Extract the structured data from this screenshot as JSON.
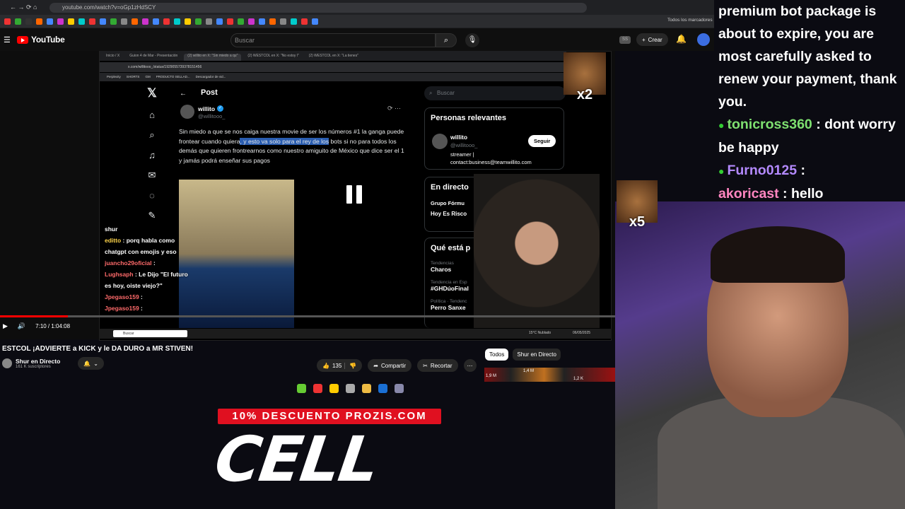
{
  "browser": {
    "url": "youtube.com/watch?v=oGp1zHdSCY",
    "bookmark_other": "Todos los marcadores"
  },
  "youtube": {
    "brand": "YouTube",
    "search_placeholder": "Buscar",
    "create_label": "Crear"
  },
  "inner_screen": {
    "url": "x.com/willitooo_/status/1929055739378151456",
    "tabs": [
      "Inicio / X",
      "Guion 4 de Mar - Presentación",
      "(2) willito en X: \"Sin miedo a qu\"",
      "(2) WESTCOL en X: \"No estoy l\"",
      "(2) WESTCOL en X: \"La tienes\""
    ],
    "bookmarks": [
      "Perplexity",
      "SHORTS",
      "GM",
      "PRODUCTO SELLAD...",
      "Descargador de vid..."
    ],
    "post_header": "Post",
    "author_name": "willito",
    "author_handle": "@willitooo_",
    "tweet_text_a": "Sin miedo a que se nos caiga nuestra movie de ser los números #1 la ganga puede frontear cuando quiera",
    "tweet_text_highlight": ", y esto va solo para el rey de los",
    "tweet_text_b": "bots si no para todos los demás que quieren frontrearnos como nuestro amiguito de México que dice ser el 1 y jamás podrá enseñar sus pagos",
    "search_placeholder": "Buscar",
    "relevant_title": "Personas relevantes",
    "relevant_name": "willito",
    "relevant_handle": "@willitooo_",
    "relevant_bio": "streamer | contact:business@teamwillito.com",
    "follow_label": "Seguir",
    "live_title": "En directo",
    "live_item_a": "Grupo Fórmu",
    "live_item_b": "Hoy Es Risco",
    "trends_title": "Qué está p",
    "trend1_cat": "Tendencias",
    "trend1": "Charos",
    "trend2_cat": "Tendencia en Esp",
    "trend2": "#GHDúoFinal",
    "trend3_cat": "Política · Tendenc",
    "trend3": "Perro Sanxe",
    "taskbar_search": "Buscar",
    "taskbar_temp": "15°C Nublado",
    "tray_date": "06/05/2025",
    "emote_x2": "x2"
  },
  "stream_chat_overlay": [
    {
      "user": "shur",
      "text": ""
    },
    {
      "user": "editto",
      "text": ": porq habla como chatgpt con emojis y eso"
    },
    {
      "user": "juancho29oficial",
      "text": ":"
    },
    {
      "user": "Lughsaph",
      "text": ": Le Dijo \"El futuro es hoy, oiste viejo?\""
    },
    {
      "user": "Jpegaso159",
      "text": ":"
    },
    {
      "user": "Jpegaso159",
      "text": ":"
    }
  ],
  "player": {
    "time": "7:10 / 1:04:08",
    "progress_fraction": 0.11
  },
  "video": {
    "title": "ESTCOL ¡ADVIERTE a KICK y le DA DURO a MR STIVEN!",
    "channel": "Shur en Directo",
    "subscribers": "161 K suscriptores",
    "likes": "135",
    "share": "Compartir",
    "clip": "Recortar"
  },
  "chips": [
    "Todos",
    "Shur en Directo"
  ],
  "thumb_labels": [
    "1,9 M",
    "1,4 M",
    "1,2 K"
  ],
  "promo": {
    "banner": "10% DESCUENTO PROZIS.COM",
    "big_text": "CELL"
  },
  "right_chat": {
    "intro": "premium bot package is about to expire, you are most carefully asked to renew your payment, thank you.",
    "messages": [
      {
        "user": "tonicross360",
        "text": ": dont worry be happy"
      },
      {
        "user": "Furno0125",
        "text": ":"
      },
      {
        "user": "akoricast",
        "text": ": hello"
      }
    ],
    "emote_x5": "x5"
  }
}
